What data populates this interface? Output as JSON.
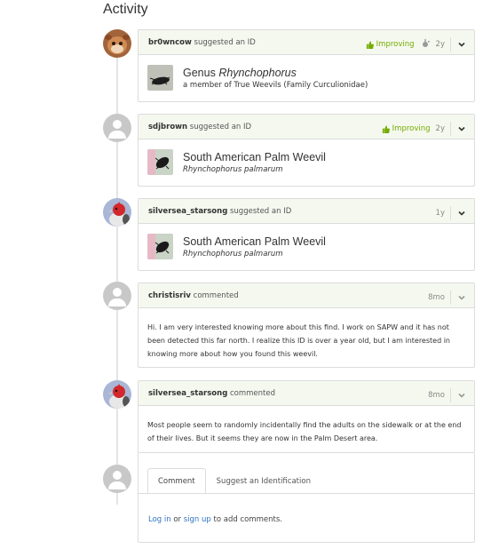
{
  "page_title": "Activity",
  "activity": [
    {
      "user": "br0wncow",
      "action": "suggested an ID",
      "status": "Improving",
      "time": "2y",
      "taxon_rank": "Genus",
      "taxon_name": "Rhynchophorus",
      "taxon_member_prefix": "a member of",
      "taxon_member_of": "True Weevils (Family Curculionidae)"
    },
    {
      "user": "sdjbrown",
      "action": "suggested an ID",
      "status": "Improving",
      "time": "2y",
      "common_name": "South American Palm Weevil",
      "sci_name": "Rhynchophorus palmarum"
    },
    {
      "user": "silversea_starsong",
      "action": "suggested an ID",
      "time": "1y",
      "common_name": "South American Palm Weevil",
      "sci_name": "Rhynchophorus palmarum"
    },
    {
      "user": "christisriv",
      "action": "commented",
      "time": "8mo",
      "text": "Hi. I am very interested knowing more about this find. I work on SAPW and it has not been detected this far north. I realize this ID is over a year old, but I am interested in knowing more about how you found this weevil."
    },
    {
      "user": "silversea_starsong",
      "action": "commented",
      "time": "8mo",
      "text": "Most people seem to randomly incidentally find the adults on the sidewalk or at the end of their lives. But it seems they are now in the Palm Desert area."
    }
  ],
  "comment_box": {
    "tab_comment": "Comment",
    "tab_suggest": "Suggest an Identification",
    "login_link": "Log in",
    "or_text": "or",
    "signup_link": "sign up",
    "suffix_text": "to add comments."
  },
  "colors": {
    "improving_green": "#74ac00",
    "link_blue": "#3173c3",
    "header_bg": "#f5f8ef"
  },
  "icons": [
    "thumbs-up-icon",
    "agree-icon",
    "chevron-down-icon",
    "user-default-icon"
  ]
}
